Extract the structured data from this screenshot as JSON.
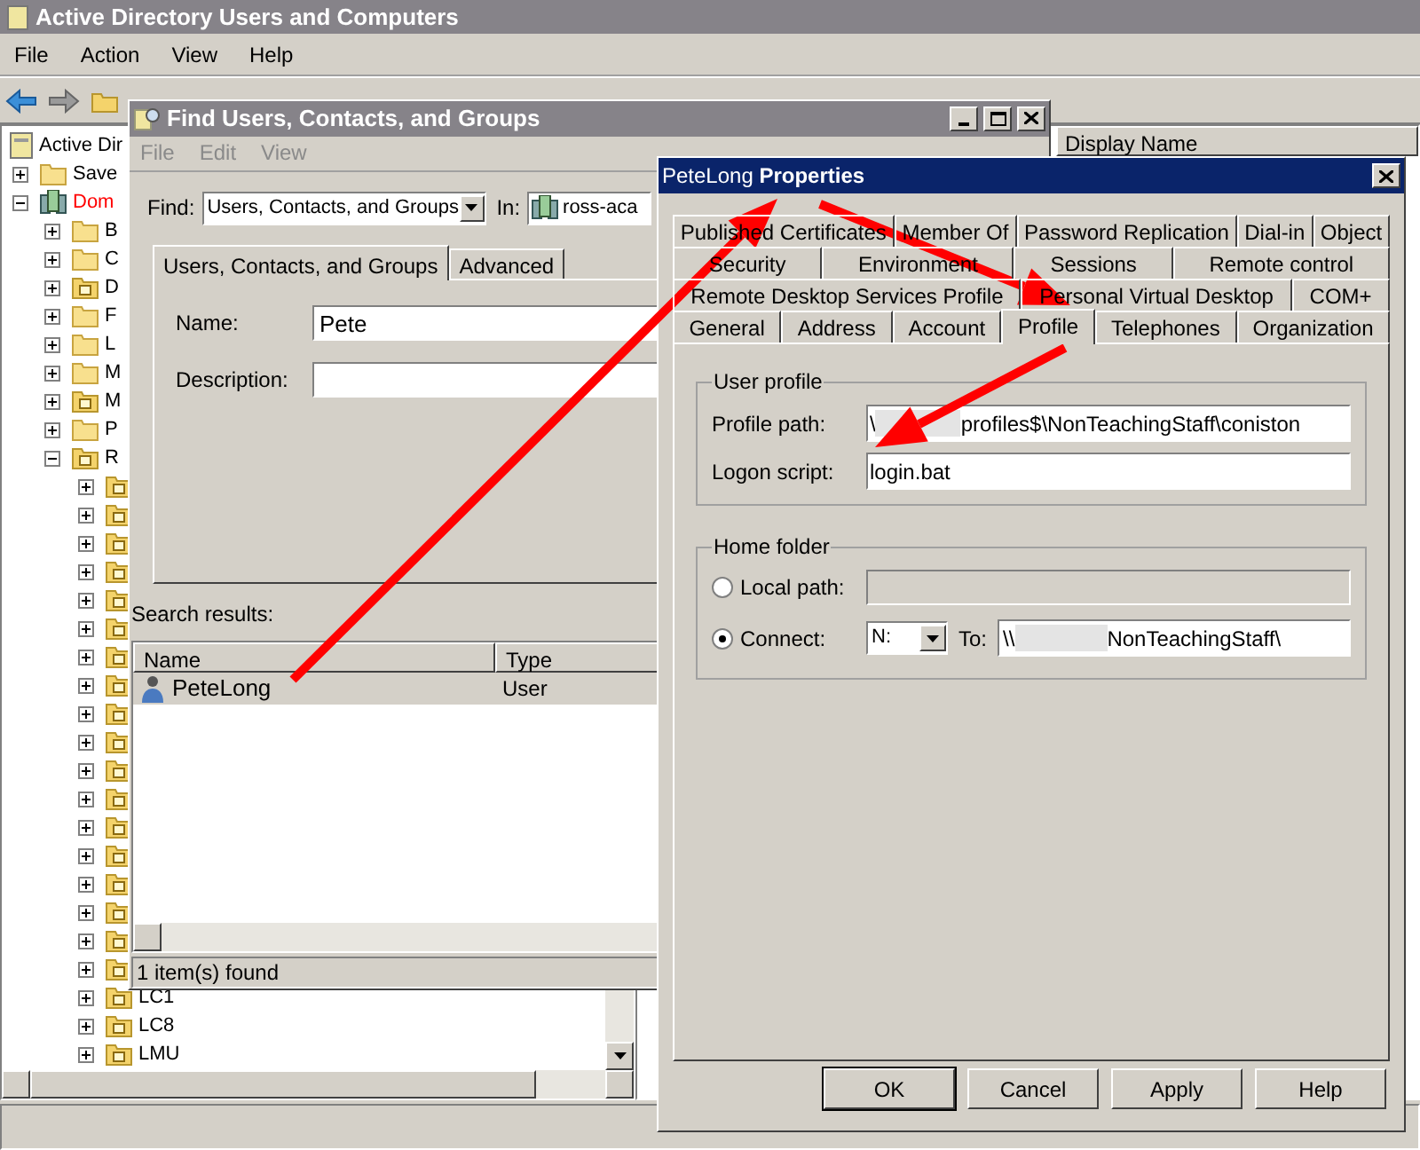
{
  "window": {
    "title": "Active Directory Users and Computers"
  },
  "menu": [
    "File",
    "Action",
    "View",
    "Help"
  ],
  "tree": [
    {
      "label": "Active Dir",
      "kind": "root",
      "children": [
        {
          "label": "Save",
          "kind": "folder",
          "expanded": false
        },
        {
          "label": "Dom",
          "kind": "domain",
          "expanded": true,
          "color": "#ff0000",
          "children": [
            {
              "label": "B",
              "kind": "folder",
              "expanded": false
            },
            {
              "label": "C",
              "kind": "folder",
              "expanded": false
            },
            {
              "label": "D",
              "kind": "ou",
              "expanded": false
            },
            {
              "label": "F",
              "kind": "folder",
              "expanded": false
            },
            {
              "label": "L",
              "kind": "folder",
              "expanded": false
            },
            {
              "label": "M",
              "kind": "folder",
              "expanded": false
            },
            {
              "label": "M",
              "kind": "ou",
              "expanded": false
            },
            {
              "label": "P",
              "kind": "folder",
              "expanded": false
            },
            {
              "label": "R",
              "kind": "ou",
              "expanded": true,
              "children": [
                {
                  "kind": "ou",
                  "expanded": false
                },
                {
                  "kind": "ou",
                  "expanded": false
                },
                {
                  "kind": "ou",
                  "expanded": false
                },
                {
                  "kind": "ou",
                  "expanded": false
                },
                {
                  "kind": "ou",
                  "expanded": false
                },
                {
                  "kind": "ou",
                  "expanded": false
                },
                {
                  "kind": "ou",
                  "expanded": false
                },
                {
                  "kind": "ou",
                  "expanded": false
                },
                {
                  "kind": "ou",
                  "expanded": false
                },
                {
                  "kind": "ou",
                  "expanded": false
                },
                {
                  "kind": "ou",
                  "expanded": false
                },
                {
                  "kind": "ou",
                  "expanded": false
                },
                {
                  "kind": "ou",
                  "expanded": false
                },
                {
                  "kind": "ou",
                  "expanded": false
                },
                {
                  "kind": "ou",
                  "expanded": false
                },
                {
                  "kind": "ou",
                  "expanded": false
                },
                {
                  "kind": "ou",
                  "expanded": false
                },
                {
                  "kind": "ou",
                  "expanded": false
                },
                {
                  "label": "LC1",
                  "kind": "ou",
                  "expanded": false
                },
                {
                  "label": "LC8",
                  "kind": "ou",
                  "expanded": false
                },
                {
                  "label": "LMU",
                  "kind": "ou",
                  "expanded": false
                }
              ]
            }
          ]
        }
      ]
    }
  ],
  "list_columns": [
    "Display Name"
  ],
  "find_dialog": {
    "title": "Find Users, Contacts, and Groups",
    "menu": [
      "File",
      "Edit",
      "View"
    ],
    "find_label": "Find:",
    "find_value": "Users, Contacts, and Groups",
    "in_label": "In:",
    "in_value": "ross-aca",
    "tabs": [
      {
        "label": "Users, Contacts, and Groups",
        "selected": true
      },
      {
        "label": "Advanced",
        "selected": false
      }
    ],
    "fields": [
      {
        "label": "Name:",
        "value": "Pete"
      },
      {
        "label": "Description:"
      }
    ],
    "results_label": "Search results:",
    "columns": [
      "Name",
      "Type"
    ],
    "rows": [
      {
        "name": "PeteLong",
        "type": "User",
        "selected": true
      }
    ],
    "status": "1 item(s) found"
  },
  "properties": {
    "title": "PeteLong **Properties**",
    "tab_rows": [
      [
        {
          "label": "Published Certificates",
          "selected": false
        },
        {
          "label": "Member Of",
          "selected": false
        },
        {
          "label": "Password Replication",
          "selected": false
        },
        {
          "label": "Dial-in",
          "selected": false
        },
        {
          "label": "Object",
          "selected": false
        }
      ],
      [
        {
          "label": "Security",
          "selected": false
        },
        {
          "label": "Environment",
          "selected": false
        },
        {
          "label": "Sessions",
          "selected": false
        },
        {
          "label": "Remote control",
          "selected": false
        }
      ],
      [
        {
          "label": "Remote Desktop Services Profile",
          "selected": false
        },
        {
          "label": "Personal Virtual Desktop",
          "selected": false
        },
        {
          "label": "COM+",
          "selected": false
        }
      ],
      [
        {
          "label": "General",
          "selected": false
        },
        {
          "label": "Address",
          "selected": false
        },
        {
          "label": "Account",
          "selected": false
        },
        {
          "label": "Profile",
          "selected": true
        },
        {
          "label": "Telephones",
          "selected": false
        },
        {
          "label": "Organization",
          "selected": false
        }
      ]
    ],
    "user_profile": {
      "legend": "User profile",
      "profile_path_label": "Profile path:",
      "profile_path_start": "\\",
      "profile_path_end": "profiles$\\NonTeachingStaff\\coniston",
      "logon_script_label": "Logon script:",
      "logon_script": "login.bat"
    },
    "home_folder": {
      "legend": "Home folder",
      "options": [
        {
          "label": "Local path:",
          "selected": false
        },
        {
          "label": "Connect:",
          "selected": true
        }
      ],
      "drive": "N:",
      "to_label": "To:",
      "to_start": "\\\\",
      "to_end": "NonTeachingStaff\\"
    },
    "buttons": [
      {
        "label": "OK",
        "default": true
      },
      {
        "label": "Cancel",
        "default": false
      },
      {
        "label": "Apply",
        "default": false
      },
      {
        "label": "Help",
        "default": false
      }
    ]
  }
}
